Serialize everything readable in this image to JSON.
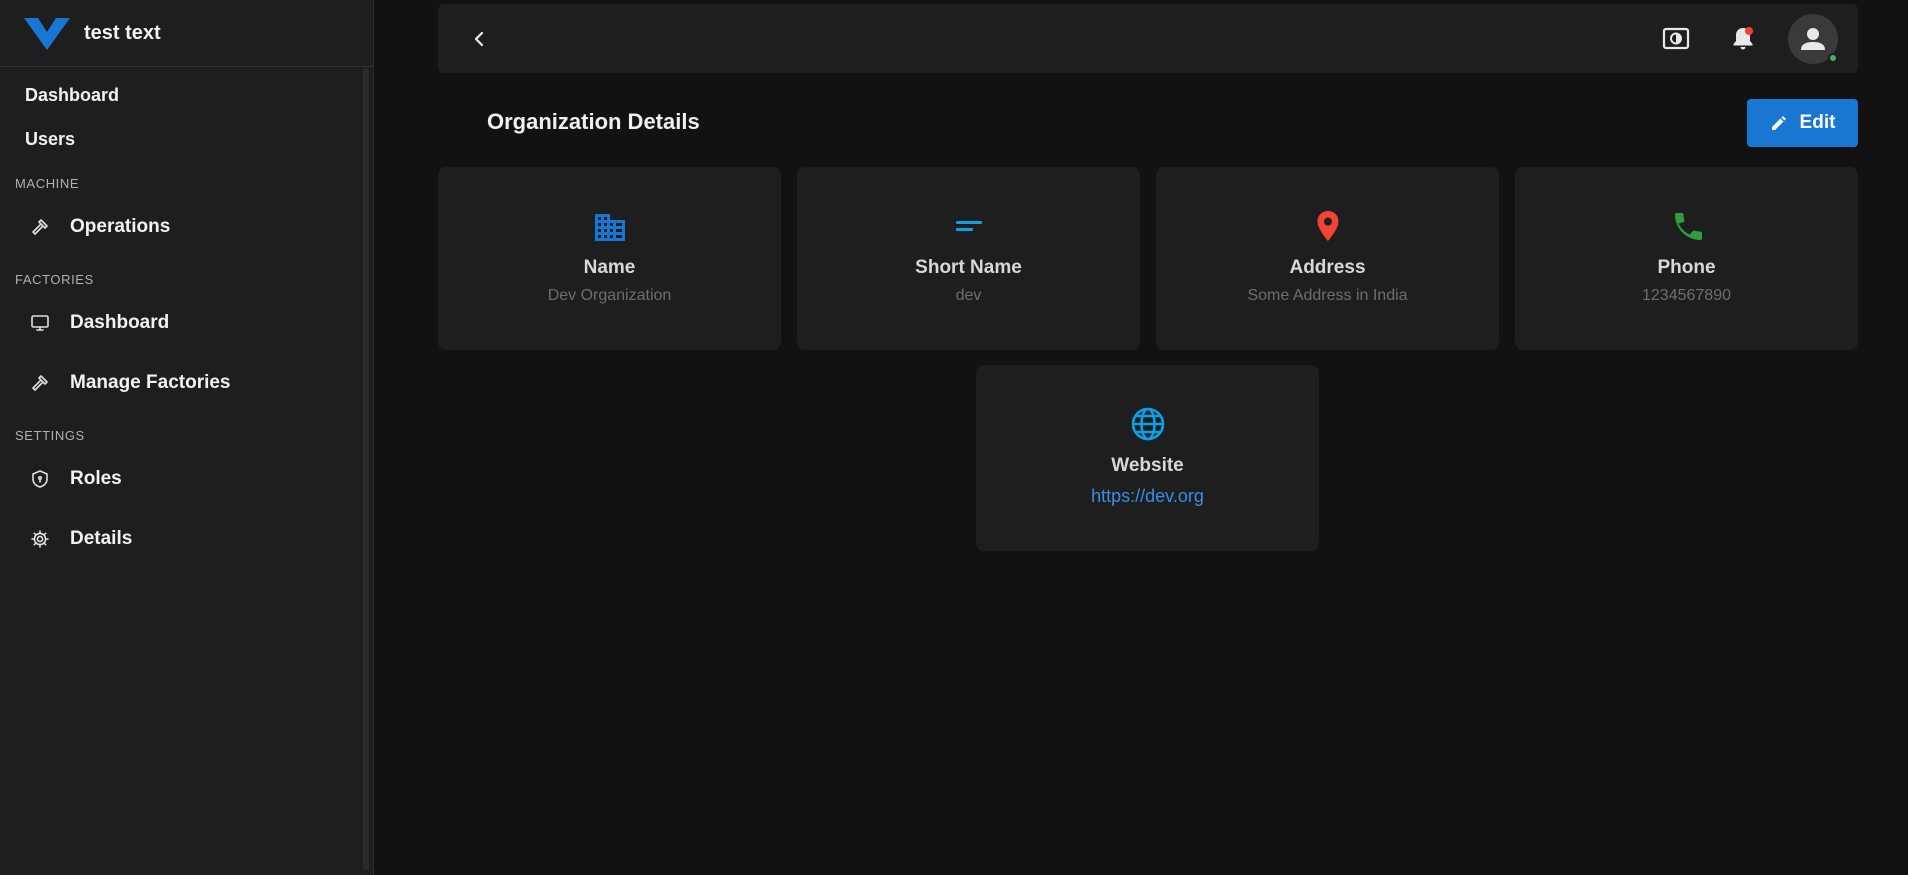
{
  "brand": {
    "title": "test text"
  },
  "nav": {
    "top_items": [
      {
        "label": "Dashboard"
      },
      {
        "label": "Users"
      }
    ],
    "sections": [
      {
        "title": "MACHINE",
        "items": [
          {
            "label": "Operations",
            "icon": "hammer-icon"
          }
        ]
      },
      {
        "title": "FACTORIES",
        "items": [
          {
            "label": "Dashboard",
            "icon": "monitor-icon"
          },
          {
            "label": "Manage Factories",
            "icon": "hammer-icon"
          }
        ]
      },
      {
        "title": "SETTINGS",
        "items": [
          {
            "label": "Roles",
            "icon": "shield-icon"
          },
          {
            "label": "Details",
            "icon": "gear-icon"
          }
        ]
      }
    ]
  },
  "header": {
    "icons": [
      "back-chevron-icon",
      "brightness-icon",
      "bell-icon",
      "user-avatar-icon"
    ]
  },
  "page": {
    "title": "Organization Details",
    "edit_label": "Edit"
  },
  "cards": [
    {
      "label": "Name",
      "value": "Dev Organization",
      "icon": "building-icon",
      "color": "#1976d2"
    },
    {
      "label": "Short Name",
      "value": "dev",
      "icon": "short-text-icon",
      "color": "#0aa0e8"
    },
    {
      "label": "Address",
      "value": "Some Address in India",
      "icon": "location-pin-icon",
      "color": "#f44336"
    },
    {
      "label": "Phone",
      "value": "1234567890",
      "icon": "phone-icon",
      "color": "#2e9e3e"
    },
    {
      "label": "Website",
      "value": "https://dev.org",
      "icon": "globe-icon",
      "color": "#0aa0e8"
    }
  ],
  "colors": {
    "accent": "#1976d2",
    "notification": "#f44336",
    "online": "#4caf50"
  }
}
